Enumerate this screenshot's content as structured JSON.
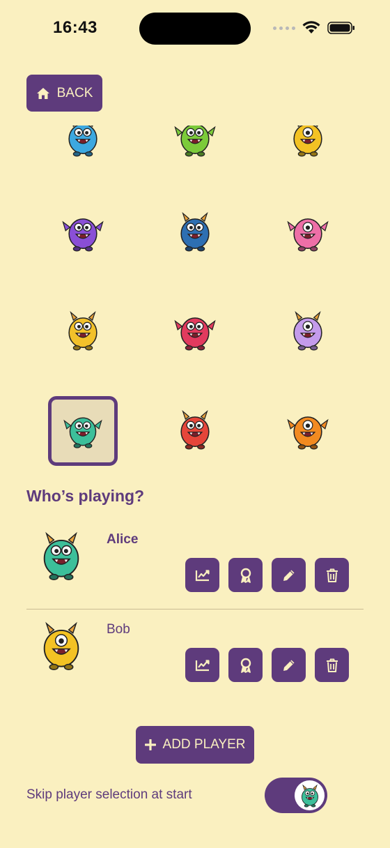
{
  "status_bar": {
    "time": "16:43"
  },
  "back_button": {
    "label": "BACK",
    "icon": "home-icon"
  },
  "avatar_grid": {
    "avatars": [
      {
        "name": "blue-horned-monster",
        "color": "#3DA8E0",
        "selected": false
      },
      {
        "name": "green-monster",
        "color": "#7CCB3A",
        "selected": false
      },
      {
        "name": "yellow-cyclops-monster",
        "color": "#F3C224",
        "selected": false
      },
      {
        "name": "purple-winged-monster",
        "color": "#8A4FD6",
        "selected": false
      },
      {
        "name": "blue-cyclops-monster",
        "color": "#2E6FB2",
        "selected": false
      },
      {
        "name": "pink-monster",
        "color": "#EE6FA7",
        "selected": false
      },
      {
        "name": "yellow-horned-monster",
        "color": "#F2C12B",
        "selected": false
      },
      {
        "name": "red-pink-monster",
        "color": "#E23B5E",
        "selected": false
      },
      {
        "name": "lilac-monster",
        "color": "#C49BEB",
        "selected": false
      },
      {
        "name": "teal-monster",
        "color": "#3DBF9A",
        "selected": true
      },
      {
        "name": "red-horned-monster",
        "color": "#E5463A",
        "selected": false
      },
      {
        "name": "orange-monster",
        "color": "#F28A21",
        "selected": false
      }
    ]
  },
  "section_title": "Who’s playing?",
  "players": [
    {
      "name": "Alice",
      "avatar_color": "#3DBF9A",
      "active": true
    },
    {
      "name": "Bob",
      "avatar_color": "#F3C224",
      "active": false
    }
  ],
  "action_icons": [
    "stats-icon",
    "award-icon",
    "edit-icon",
    "delete-icon"
  ],
  "add_button": {
    "label": "ADD PLAYER",
    "icon": "plus-icon"
  },
  "skip_selection": {
    "label": "Skip player selection at start",
    "enabled": true
  },
  "colors": {
    "background": "#FAF0C0",
    "accent": "#5E3B7C"
  }
}
